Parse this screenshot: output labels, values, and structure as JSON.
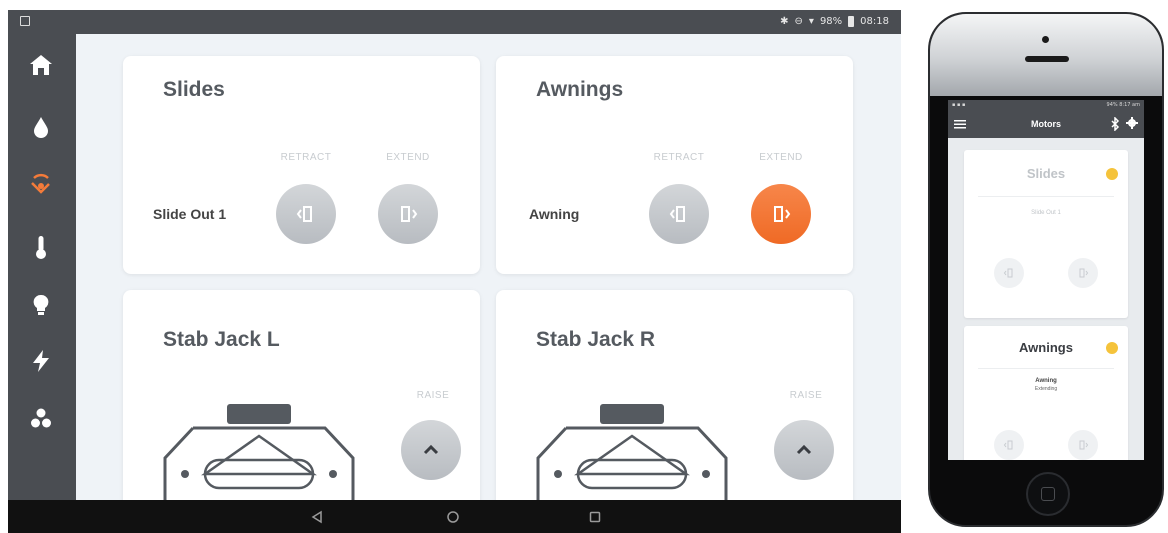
{
  "colors": {
    "accent": "#f47b3a",
    "sidebar": "#4a4d52",
    "background": "#eff3f7",
    "indicator": "#f5c33b"
  },
  "tablet": {
    "status": {
      "battery": "98%",
      "time": "08:18"
    },
    "sidebar": [
      {
        "name": "home-icon"
      },
      {
        "name": "water-drop-icon"
      },
      {
        "name": "motors-icon",
        "active": true
      },
      {
        "name": "thermometer-icon"
      },
      {
        "name": "lightbulb-icon"
      },
      {
        "name": "lightning-icon"
      },
      {
        "name": "fan-icon"
      }
    ],
    "slides": {
      "title": "Slides",
      "retract": "RETRACT",
      "extend": "EXTEND",
      "row": "Slide Out 1"
    },
    "awnings": {
      "title": "Awnings",
      "retract": "RETRACT",
      "extend": "EXTEND",
      "row": "Awning"
    },
    "jack_left": {
      "title": "Stab Jack L",
      "raise": "RAISE"
    },
    "jack_right": {
      "title": "Stab Jack R",
      "raise": "RAISE"
    }
  },
  "phone": {
    "status": {
      "battery": "94%",
      "time": "8:17 am"
    },
    "title": "Motors",
    "slides": {
      "title": "Slides",
      "row": "Slide Out 1"
    },
    "awnings": {
      "title": "Awnings",
      "row": "Awning",
      "state": "Extending"
    }
  }
}
